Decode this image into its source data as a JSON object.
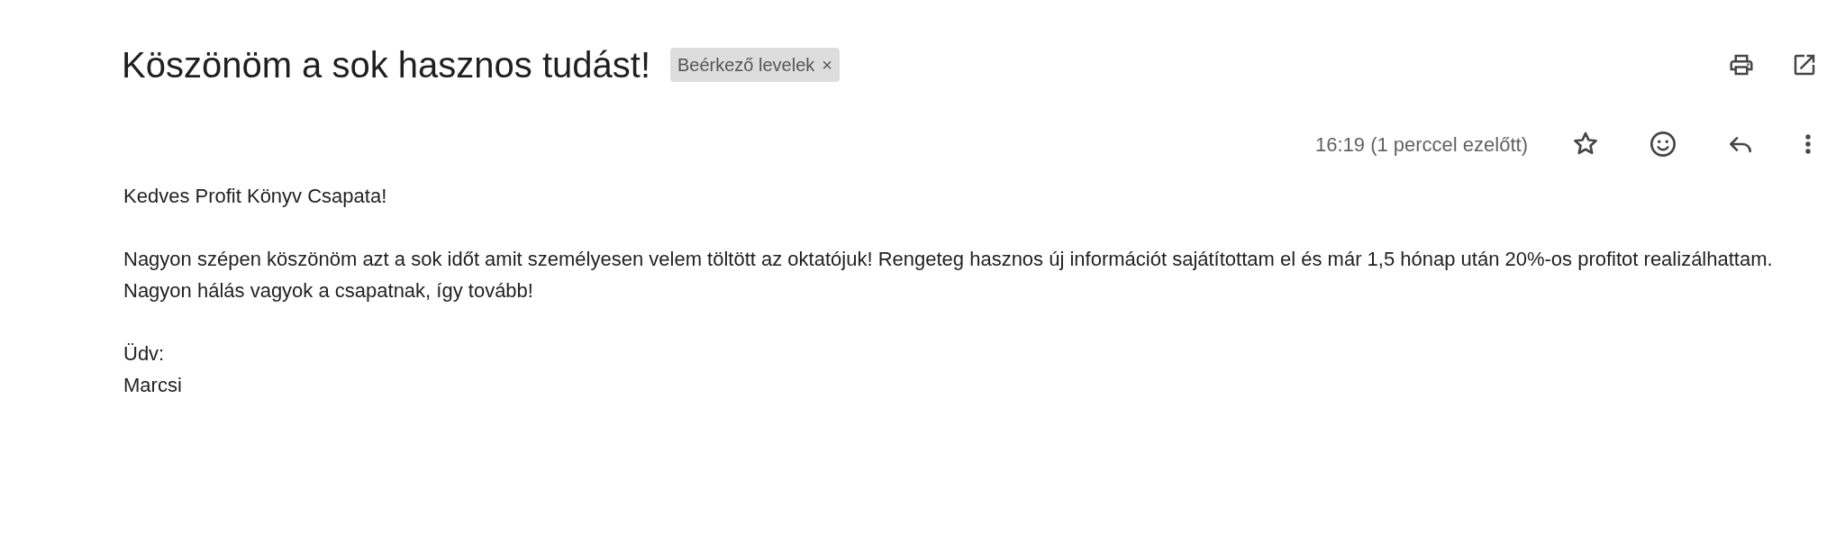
{
  "subject": "Köszönöm a sok hasznos tudást!",
  "label": {
    "text": "Beérkező levelek",
    "remove": "×"
  },
  "timestamp": "16:19 (1 perccel ezelőtt)",
  "starred": false,
  "body": [
    "Kedves Profit Könyv Csapata!",
    "Nagyon szépen köszönöm azt a sok időt amit személyesen velem töltött az oktatójuk! Rengeteg hasznos új információt sajátítottam el és már 1,5 hónap után 20%-os profitot realizálhattam. Nagyon hálás vagyok a csapatnak, így tovább!",
    "Üdv:\nMarcsi"
  ]
}
